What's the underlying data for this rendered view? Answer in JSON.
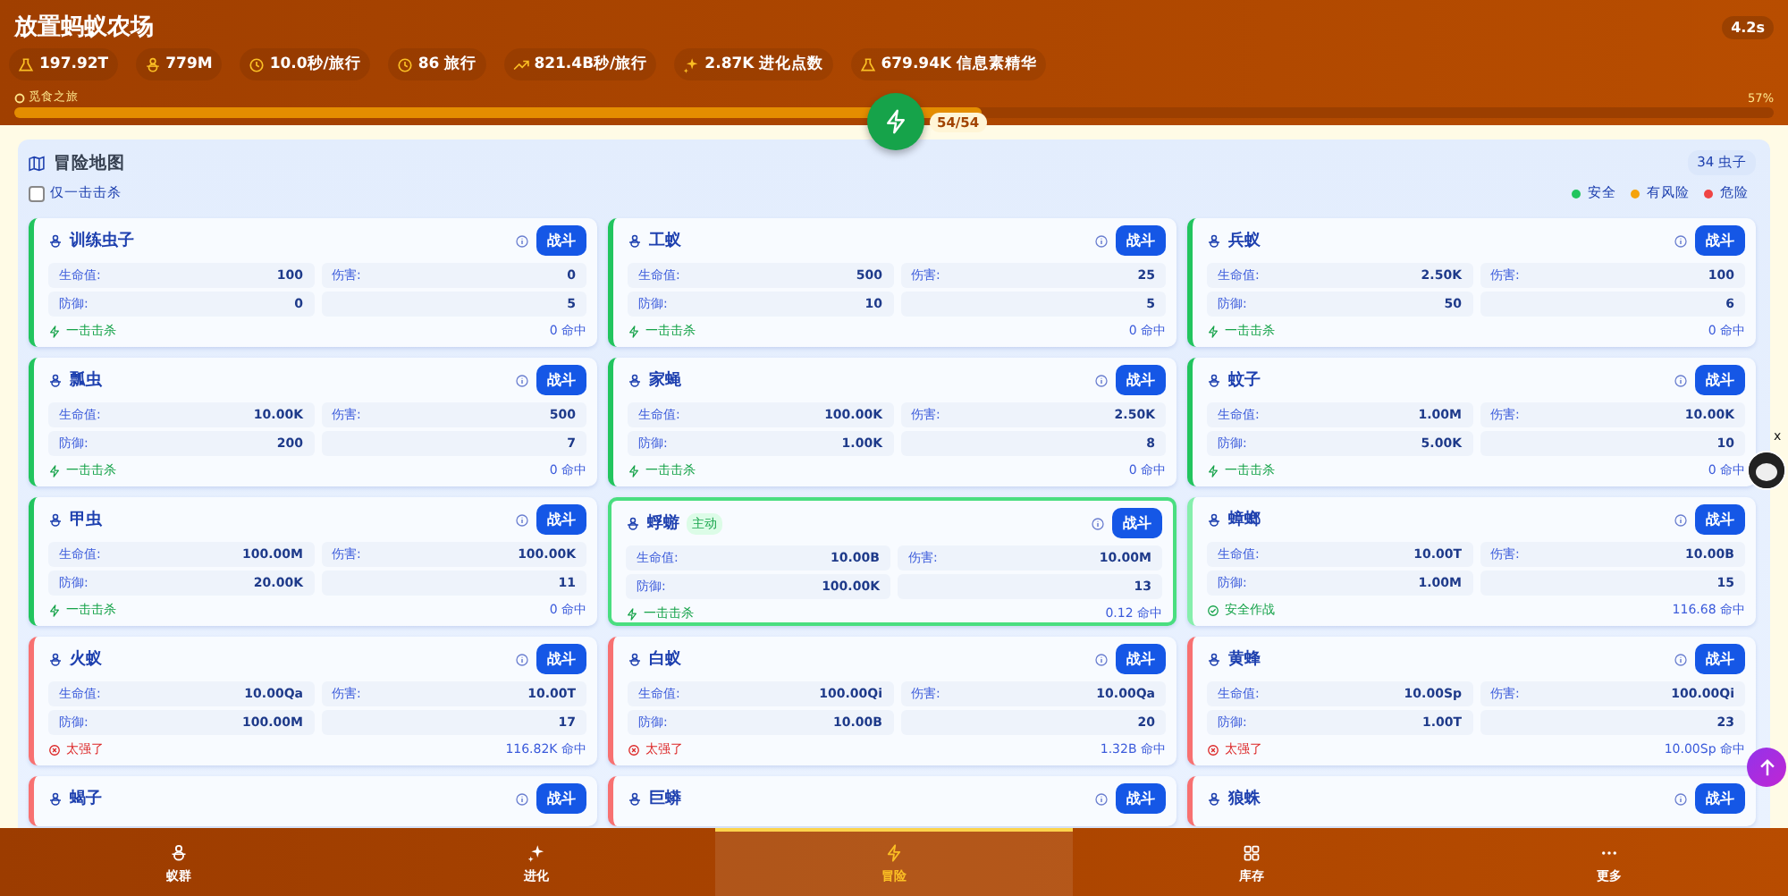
{
  "app": {
    "title": "放置蚂蚁农场",
    "timer": "4.2s"
  },
  "stats": [
    {
      "kind": "flask",
      "text": "197.92T"
    },
    {
      "kind": "ant",
      "text": "779M"
    },
    {
      "kind": "clock",
      "text": "10.0秒/旅行"
    },
    {
      "kind": "clock",
      "text": "86 旅行"
    },
    {
      "kind": "trend",
      "text": "821.4B秒/旅行"
    },
    {
      "kind": "sparkle",
      "text": "2.87K 进化点数"
    },
    {
      "kind": "flask",
      "text": "679.94K 信息素精华"
    }
  ],
  "journey": {
    "label": "觅食之旅",
    "percent": "57%",
    "level": 0.55,
    "counter": "54/54"
  },
  "map": {
    "title": "冒险地图",
    "count": "34 虫子",
    "filter": {
      "label": "仅一击击杀",
      "checked": false
    },
    "legend": [
      {
        "label": "安全",
        "color": "#22c55e"
      },
      {
        "label": "有风险",
        "color": "#f5a30b"
      },
      {
        "label": "危险",
        "color": "#ef4444"
      }
    ]
  },
  "enemies": [
    {
      "name": "训练虫子",
      "hp_label": "生命值:",
      "hp": "100",
      "dmg_label": "伤害:",
      "dmg": "0",
      "def_label": "防御:",
      "def": "0",
      "stat_4": "5",
      "status": {
        "kind": "one_hit",
        "text": "一击击杀"
      },
      "hits": "0 命中",
      "highlighted": false,
      "fight": "战斗"
    },
    {
      "name": "工蚁",
      "hp_label": "生命值:",
      "hp": "500",
      "dmg_label": "伤害:",
      "dmg": "25",
      "def_label": "防御:",
      "def": "10",
      "stat_4": "5",
      "status": {
        "kind": "one_hit",
        "text": "一击击杀"
      },
      "hits": "0 命中",
      "highlighted": false,
      "fight": "战斗"
    },
    {
      "name": "兵蚁",
      "hp_label": "生命值:",
      "hp": "2.50K",
      "dmg_label": "伤害:",
      "dmg": "100",
      "def_label": "防御:",
      "def": "50",
      "stat_4": "6",
      "status": {
        "kind": "one_hit",
        "text": "一击击杀"
      },
      "hits": "0 命中",
      "highlighted": false,
      "fight": "战斗"
    },
    {
      "name": "瓢虫",
      "hp_label": "生命值:",
      "hp": "10.00K",
      "dmg_label": "伤害:",
      "dmg": "500",
      "def_label": "防御:",
      "def": "200",
      "stat_4": "7",
      "status": {
        "kind": "one_hit",
        "text": "一击击杀"
      },
      "hits": "0 命中",
      "highlighted": false,
      "fight": "战斗"
    },
    {
      "name": "家蝇",
      "hp_label": "生命值:",
      "hp": "100.00K",
      "dmg_label": "伤害:",
      "dmg": "2.50K",
      "def_label": "防御:",
      "def": "1.00K",
      "stat_4": "8",
      "status": {
        "kind": "one_hit",
        "text": "一击击杀"
      },
      "hits": "0 命中",
      "highlighted": false,
      "fight": "战斗"
    },
    {
      "name": "蚊子",
      "hp_label": "生命值:",
      "hp": "1.00M",
      "dmg_label": "伤害:",
      "dmg": "10.00K",
      "def_label": "防御:",
      "def": "5.00K",
      "stat_4": "10",
      "status": {
        "kind": "one_hit",
        "text": "一击击杀"
      },
      "hits": "0 命中",
      "highlighted": false,
      "fight": "战斗"
    },
    {
      "name": "甲虫",
      "hp_label": "生命值:",
      "hp": "100.00M",
      "dmg_label": "伤害:",
      "dmg": "100.00K",
      "def_label": "防御:",
      "def": "20.00K",
      "stat_4": "11",
      "status": {
        "kind": "one_hit",
        "text": "一击击杀"
      },
      "hits": "0 命中",
      "highlighted": false,
      "fight": "战斗"
    },
    {
      "name": "蜉蝣",
      "tag": "主动",
      "hp_label": "生命值:",
      "hp": "10.00B",
      "dmg_label": "伤害:",
      "dmg": "10.00M",
      "def_label": "防御:",
      "def": "100.00K",
      "stat_4": "13",
      "status": {
        "kind": "one_hit",
        "text": "一击击杀"
      },
      "hits": "0.12 命中",
      "highlighted": true,
      "fight": "战斗"
    },
    {
      "name": "蟑螂",
      "hp_label": "生命值:",
      "hp": "10.00T",
      "dmg_label": "伤害:",
      "dmg": "10.00B",
      "def_label": "防御:",
      "def": "1.00M",
      "stat_4": "15",
      "status": {
        "kind": "safe",
        "text": "安全作战"
      },
      "hits": "116.68 命中",
      "highlighted": false,
      "fight": "战斗"
    },
    {
      "name": "火蚁",
      "hp_label": "生命值:",
      "hp": "10.00Qa",
      "dmg_label": "伤害:",
      "dmg": "10.00T",
      "def_label": "防御:",
      "def": "100.00M",
      "stat_4": "17",
      "status": {
        "kind": "danger",
        "text": "太强了"
      },
      "hits": "116.82K 命中",
      "highlighted": false,
      "fight": "战斗"
    },
    {
      "name": "白蚁",
      "hp_label": "生命值:",
      "hp": "100.00Qi",
      "dmg_label": "伤害:",
      "dmg": "10.00Qa",
      "def_label": "防御:",
      "def": "10.00B",
      "stat_4": "20",
      "status": {
        "kind": "danger",
        "text": "太强了"
      },
      "hits": "1.32B 命中",
      "highlighted": false,
      "fight": "战斗"
    },
    {
      "name": "黄蜂",
      "hp_label": "生命值:",
      "hp": "10.00Sp",
      "dmg_label": "伤害:",
      "dmg": "100.00Qi",
      "def_label": "防御:",
      "def": "1.00T",
      "stat_4": "23",
      "status": {
        "kind": "danger",
        "text": "太强了"
      },
      "hits": "10.00Sp 命中",
      "highlighted": false,
      "fight": "战斗"
    },
    {
      "name": "蝎子",
      "kind": "danger",
      "highlighted": false,
      "fight": "战斗"
    },
    {
      "name": "巨蟒",
      "kind": "danger",
      "highlighted": false,
      "fight": "战斗"
    },
    {
      "name": "狼蛛",
      "kind": "danger",
      "highlighted": false,
      "fight": "战斗"
    }
  ],
  "helper": {
    "close": "x"
  },
  "nav": [
    {
      "kind": "ant",
      "label": "蚁群",
      "selected": false
    },
    {
      "kind": "sparkle",
      "label": "进化",
      "selected": false
    },
    {
      "kind": "bolt",
      "label": "冒险",
      "selected": true
    },
    {
      "kind": "grid",
      "label": "库存",
      "selected": false
    },
    {
      "kind": "dots",
      "label": "更多",
      "selected": false
    }
  ]
}
